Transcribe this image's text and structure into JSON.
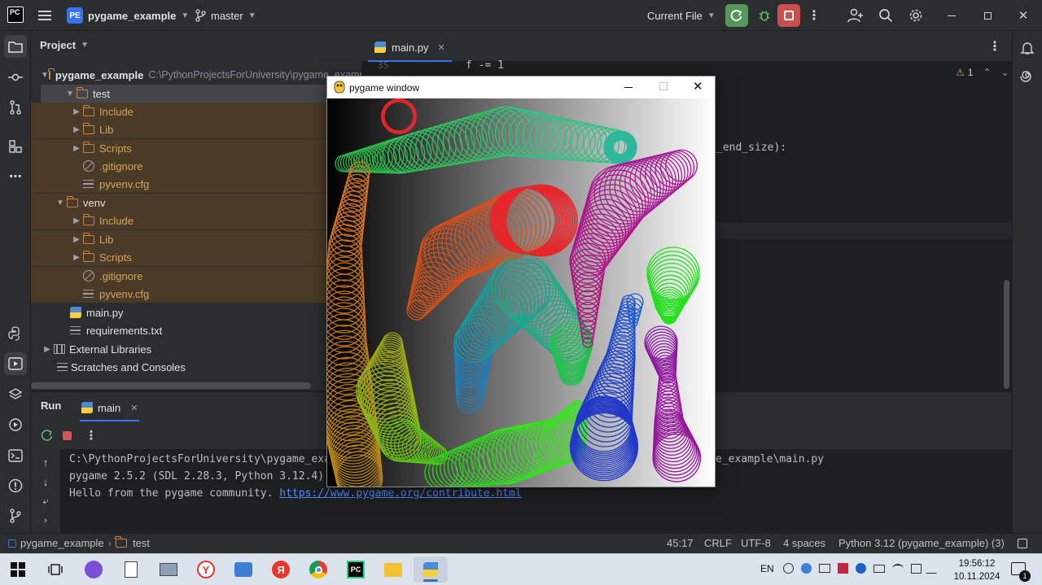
{
  "titlebar": {
    "app_icon": "PC",
    "project_badge": "PE",
    "project_name": "pygame_example",
    "branch_name": "master",
    "run_config": "Current File"
  },
  "project_panel": {
    "title": "Project",
    "root_name": "pygame_example",
    "root_path": "C:\\PythonProjectsForUniversity\\pygame_example",
    "items": [
      {
        "label": "test"
      },
      {
        "label": "Include"
      },
      {
        "label": "Lib"
      },
      {
        "label": "Scripts"
      },
      {
        "label": ".gitignore"
      },
      {
        "label": "pyvenv.cfg"
      },
      {
        "label": "venv"
      },
      {
        "label": "Include"
      },
      {
        "label": "Lib"
      },
      {
        "label": "Scripts"
      },
      {
        "label": ".gitignore"
      },
      {
        "label": "pyvenv.cfg"
      },
      {
        "label": "main.py"
      },
      {
        "label": "requirements.txt"
      },
      {
        "label": "External Libraries"
      },
      {
        "label": "Scratches and Consoles"
      }
    ]
  },
  "editor": {
    "tab_label": "main.py",
    "line_number": "35",
    "code_line_top": "f -= 1",
    "code_line_visible": "_end_size):",
    "warning_count": "1"
  },
  "run_panel": {
    "title": "Run",
    "tab_label": "main",
    "console": {
      "line1_start": "C:\\PythonProjectsForUniversity\\pygame_exam",
      "line1_end": "e_example\\main.py",
      "line2": "pygame 2.5.2 (SDL 2.28.3, Python 3.12.4)",
      "line3_text": "Hello from the pygame community. ",
      "line3_link": "https://www.pygame.org/contribute.html"
    }
  },
  "pygame_window": {
    "title": "pygame window"
  },
  "statusbar": {
    "breadcrumb_project": "pygame_example",
    "breadcrumb_folder": "test",
    "position": "45:17",
    "line_ending": "CRLF",
    "encoding": "UTF-8",
    "indent": "4 spaces",
    "interpreter": "Python 3.12 (pygame_example) (3)"
  },
  "taskbar": {
    "language": "EN",
    "time": "19:56:12",
    "date": "10.11.2024",
    "notification_count": "1"
  }
}
